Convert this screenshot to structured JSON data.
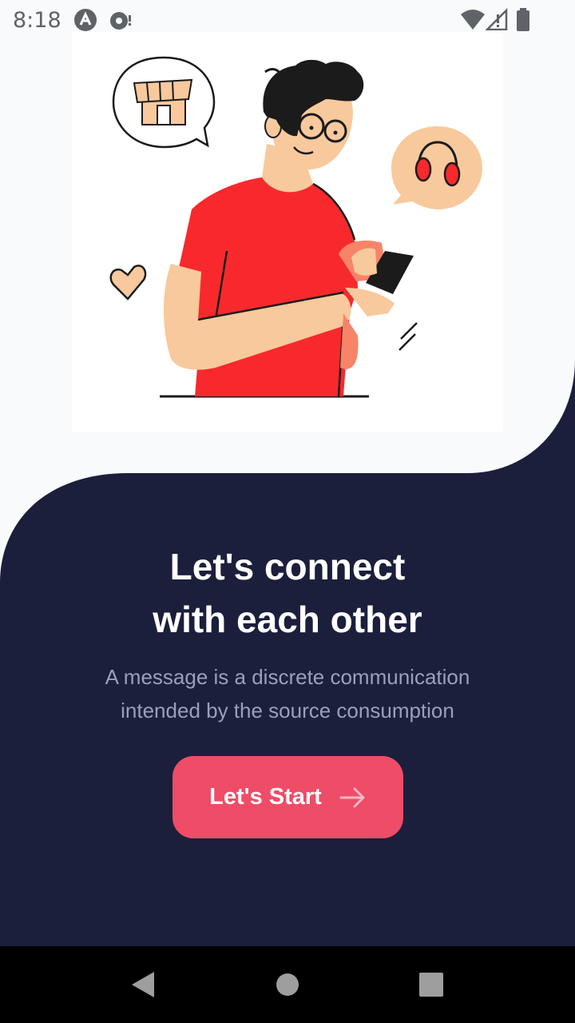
{
  "status_bar": {
    "time": "8:18",
    "left_icons": [
      "a-circle-icon",
      "media-disc-icon"
    ],
    "right_icons": [
      "wifi-icon",
      "signal-icon",
      "battery-icon"
    ]
  },
  "onboarding": {
    "headline_line1": "Let's connect",
    "headline_line2": "with each other",
    "subtitle_line1": "A message is a discrete communication",
    "subtitle_line2": "intended by the source consumption",
    "cta_label": "Let's Start",
    "cta_icon": "arrow-right-icon"
  },
  "nav_bar": {
    "buttons": [
      "back-icon",
      "home-icon",
      "recents-icon"
    ]
  },
  "colors": {
    "background_light": "#f9fafc",
    "panel_dark": "#1b1f3b",
    "accent": "#ef4c67",
    "subtitle": "#9b9fb8",
    "shirt": "#f8292d",
    "skin": "#f9c9a0"
  }
}
